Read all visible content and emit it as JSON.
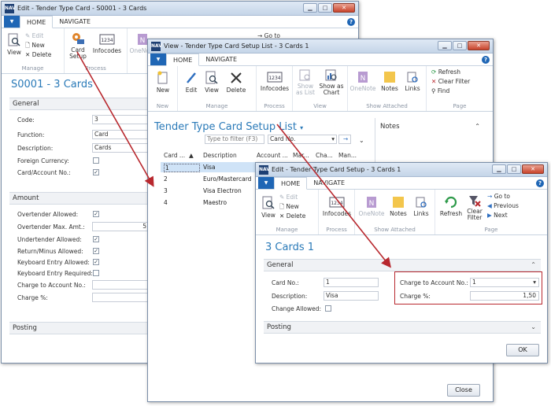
{
  "win1": {
    "title": "Edit - Tender Type Card - S0001 - 3 Cards",
    "tabs": [
      "HOME",
      "NAVIGATE"
    ],
    "ribbon": {
      "view": "View",
      "edit": "Edit",
      "new": "New",
      "delete": "Delete",
      "card_setup": "Card Setup",
      "infocodes": "Infocodes",
      "onenote": "OneNote",
      "go_to": "Go to",
      "group_manage": "Manage",
      "group_process": "Process"
    },
    "page_title": "S0001 - 3 Cards",
    "general": {
      "header": "General",
      "code_label": "Code:",
      "code_value": "3",
      "function_label": "Function:",
      "function_value": "Card",
      "description_label": "Description:",
      "description_value": "Cards",
      "foreign_currency_label": "Foreign Currency:",
      "card_account_label": "Card/Account No.:",
      "check": "✓"
    },
    "amount": {
      "header": "Amount",
      "overtender_allowed": "Overtender Allowed:",
      "overtender_max": "Overtender Max. Amt.:",
      "overtender_max_value": "5",
      "undertender_allowed": "Undertender Allowed:",
      "return_minus": "Return/Minus Allowed:",
      "keyboard_allowed": "Keyboard Entry Allowed:",
      "keyboard_required": "Keyboard Entry Required:",
      "charge_account": "Charge to Account No.:",
      "charge_pct": "Charge %:"
    },
    "posting": {
      "header": "Posting"
    }
  },
  "win2": {
    "title": "View - Tender Type Card Setup List - 3 Cards 1",
    "tabs": [
      "HOME",
      "NAVIGATE"
    ],
    "ribbon": {
      "new": "New",
      "edit": "Edit",
      "view": "View",
      "delete": "Delete",
      "infocodes": "Infocodes",
      "show_as_list": "Show as List",
      "show_as_chart": "Show as Chart",
      "onenote": "OneNote",
      "notes": "Notes",
      "links": "Links",
      "refresh": "Refresh",
      "clear_filter": "Clear Filter",
      "find": "Find",
      "group_new": "New",
      "group_manage": "Manage",
      "group_process": "Process",
      "group_view": "View",
      "group_show_attached": "Show Attached",
      "group_page": "Page"
    },
    "page_title": "Tender Type Card Setup List",
    "filter_placeholder": "Type to filter (F3)",
    "filter_field": "Card No.",
    "columns": [
      "Card ...",
      "Description",
      "Account ...",
      "Mar...",
      "Cha...",
      "Man..."
    ],
    "rows": [
      {
        "card": "1",
        "description": "Visa"
      },
      {
        "card": "2",
        "description": "Euro/Mastercard"
      },
      {
        "card": "3",
        "description": "Visa Electron"
      },
      {
        "card": "4",
        "description": "Maestro"
      }
    ],
    "notes_header": "Notes",
    "close_button": "Close"
  },
  "win3": {
    "title": "Edit - Tender Type Card Setup - 3 Cards 1",
    "tabs": [
      "HOME",
      "NAVIGATE"
    ],
    "ribbon": {
      "view": "View",
      "edit": "Edit",
      "new": "New",
      "delete": "Delete",
      "infocodes": "Infocodes",
      "onenote": "OneNote",
      "notes": "Notes",
      "links": "Links",
      "refresh": "Refresh",
      "clear_filter": "Clear Filter",
      "go_to": "Go to",
      "previous": "Previous",
      "next": "Next",
      "group_manage": "Manage",
      "group_process": "Process",
      "group_show_attached": "Show Attached",
      "group_page": "Page"
    },
    "page_title": "3 Cards 1",
    "general": {
      "header": "General",
      "card_no_label": "Card No.:",
      "card_no_value": "1",
      "description_label": "Description:",
      "description_value": "Visa",
      "change_allowed_label": "Change Allowed:",
      "charge_account_label": "Charge to Account No.:",
      "charge_account_value": "1",
      "charge_pct_label": "Charge %:",
      "charge_pct_value": "1,50"
    },
    "posting": {
      "header": "Posting"
    },
    "ok_button": "OK"
  },
  "colors": {
    "accent": "#2a7ab8",
    "app_button": "#1f66b5",
    "highlight": "#b8282e"
  }
}
